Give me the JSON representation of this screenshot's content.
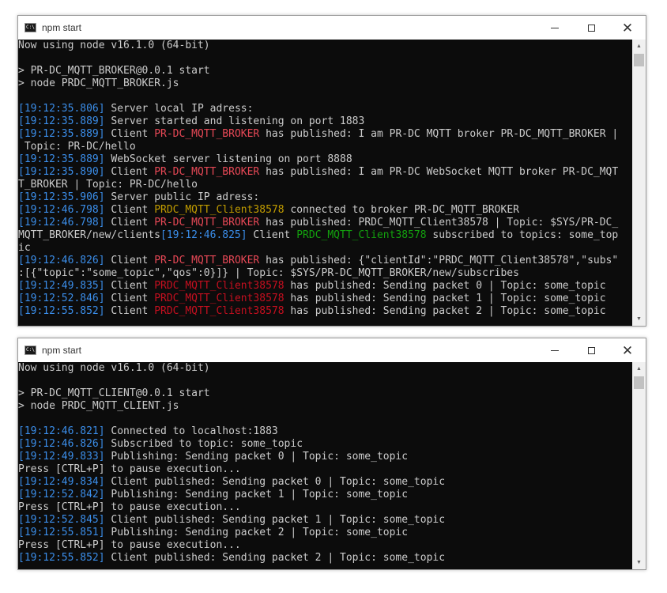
{
  "windows": [
    {
      "title": "npm start",
      "lines": [
        [
          {
            "t": "Now using node v16.1.0 (64-bit)"
          }
        ],
        [],
        [
          {
            "t": "> PR-DC_MQTT_BROKER@0.0.1 start"
          }
        ],
        [
          {
            "t": "> node PRDC_MQTT_BROKER.js"
          }
        ],
        [],
        [
          {
            "t": "[19:12:35.806]",
            "c": "ts"
          },
          {
            "t": " Server local IP adress:"
          }
        ],
        [
          {
            "t": "[19:12:35.889]",
            "c": "ts"
          },
          {
            "t": " Server started and listening on port 1883"
          }
        ],
        [
          {
            "t": "[19:12:35.889]",
            "c": "ts"
          },
          {
            "t": " Client "
          },
          {
            "t": "PR-DC_MQTT_BROKER",
            "c": "br"
          },
          {
            "t": " has published: I am PR-DC MQTT broker PR-DC_MQTT_BROKER |"
          }
        ],
        [
          {
            "t": " Topic: PR-DC/hello"
          }
        ],
        [
          {
            "t": "[19:12:35.889]",
            "c": "ts"
          },
          {
            "t": " WebSocket server listening on port 8888"
          }
        ],
        [
          {
            "t": "[19:12:35.890]",
            "c": "ts"
          },
          {
            "t": " Client "
          },
          {
            "t": "PR-DC_MQTT_BROKER",
            "c": "br"
          },
          {
            "t": " has published: I am PR-DC WebSocket MQTT broker PR-DC_MQT"
          }
        ],
        [
          {
            "t": "T_BROKER | Topic: PR-DC/hello"
          }
        ],
        [
          {
            "t": "[19:12:35.906]",
            "c": "ts"
          },
          {
            "t": " Server public IP adress:"
          }
        ],
        [
          {
            "t": "[19:12:46.798]",
            "c": "ts"
          },
          {
            "t": " Client "
          },
          {
            "t": "PRDC_MQTT_Client38578",
            "c": "cl-y"
          },
          {
            "t": " connected to broker PR-DC_MQTT_BROKER"
          }
        ],
        [
          {
            "t": "[19:12:46.798]",
            "c": "ts"
          },
          {
            "t": " Client "
          },
          {
            "t": "PR-DC_MQTT_BROKER",
            "c": "br"
          },
          {
            "t": " has published: PRDC_MQTT_Client38578 | Topic: $SYS/PR-DC_"
          }
        ],
        [
          {
            "t": "MQTT_BROKER/new/clients"
          },
          {
            "t": "[19:12:46.825]",
            "c": "ts"
          },
          {
            "t": " Client "
          },
          {
            "t": "PRDC_MQTT_Client38578",
            "c": "cl-g"
          },
          {
            "t": " subscribed to topics: some_top"
          }
        ],
        [
          {
            "t": "ic"
          }
        ],
        [
          {
            "t": "[19:12:46.826]",
            "c": "ts"
          },
          {
            "t": " Client "
          },
          {
            "t": "PR-DC_MQTT_BROKER",
            "c": "br"
          },
          {
            "t": " has published: {\"clientId\":\"PRDC_MQTT_Client38578\",\"subs\""
          }
        ],
        [
          {
            "t": ":[{\"topic\":\"some_topic\",\"qos\":0}]} | Topic: $SYS/PR-DC_MQTT_BROKER/new/subscribes"
          }
        ],
        [
          {
            "t": "[19:12:49.835]",
            "c": "ts"
          },
          {
            "t": " Client "
          },
          {
            "t": "PRDC_MQTT_Client38578",
            "c": "cl-r"
          },
          {
            "t": " has published: Sending packet 0 | Topic: some_topic"
          }
        ],
        [
          {
            "t": "[19:12:52.846]",
            "c": "ts"
          },
          {
            "t": " Client "
          },
          {
            "t": "PRDC_MQTT_Client38578",
            "c": "cl-r"
          },
          {
            "t": " has published: Sending packet 1 | Topic: some_topic"
          }
        ],
        [
          {
            "t": "[19:12:55.852]",
            "c": "ts"
          },
          {
            "t": " Client "
          },
          {
            "t": "PRDC_MQTT_Client38578",
            "c": "cl-r"
          },
          {
            "t": " has published: Sending packet 2 | Topic: some_topic"
          }
        ]
      ]
    },
    {
      "title": "npm start",
      "lines": [
        [
          {
            "t": "Now using node v16.1.0 (64-bit)"
          }
        ],
        [],
        [
          {
            "t": "> PR-DC_MQTT_CLIENT@0.0.1 start"
          }
        ],
        [
          {
            "t": "> node PRDC_MQTT_CLIENT.js"
          }
        ],
        [],
        [
          {
            "t": "[19:12:46.821]",
            "c": "ts"
          },
          {
            "t": " Connected to localhost:1883"
          }
        ],
        [
          {
            "t": "[19:12:46.826]",
            "c": "ts"
          },
          {
            "t": " Subscribed to topic: some_topic"
          }
        ],
        [
          {
            "t": "[19:12:49.833]",
            "c": "ts"
          },
          {
            "t": " Publishing: Sending packet 0 | Topic: some_topic"
          }
        ],
        [
          {
            "t": "Press [CTRL+P] to pause execution..."
          }
        ],
        [
          {
            "t": "[19:12:49.834]",
            "c": "ts"
          },
          {
            "t": " Client published: Sending packet 0 | Topic: some_topic"
          }
        ],
        [
          {
            "t": "[19:12:52.842]",
            "c": "ts"
          },
          {
            "t": " Publishing: Sending packet 1 | Topic: some_topic"
          }
        ],
        [
          {
            "t": "Press [CTRL+P] to pause execution..."
          }
        ],
        [
          {
            "t": "[19:12:52.845]",
            "c": "ts"
          },
          {
            "t": " Client published: Sending packet 1 | Topic: some_topic"
          }
        ],
        [
          {
            "t": "[19:12:55.851]",
            "c": "ts"
          },
          {
            "t": " Publishing: Sending packet 2 | Topic: some_topic"
          }
        ],
        [
          {
            "t": "Press [CTRL+P] to pause execution..."
          }
        ],
        [
          {
            "t": "[19:12:55.852]",
            "c": "ts"
          },
          {
            "t": " Client published: Sending packet 2 | Topic: some_topic"
          }
        ]
      ]
    }
  ],
  "icons": {
    "app": "console-icon",
    "minimize": "minimize-icon",
    "maximize": "maximize-icon",
    "close": "close-icon",
    "scroll_up": "scroll-up-arrow-icon",
    "scroll_down": "scroll-down-arrow-icon"
  },
  "colors": {
    "background": "#0c0c0c",
    "text": "#cccccc",
    "timestamp": "#3b8eea",
    "broker_name": "#e74856",
    "client_red": "#c50f1f",
    "client_yellow": "#c19c00",
    "client_green": "#13a10e"
  }
}
